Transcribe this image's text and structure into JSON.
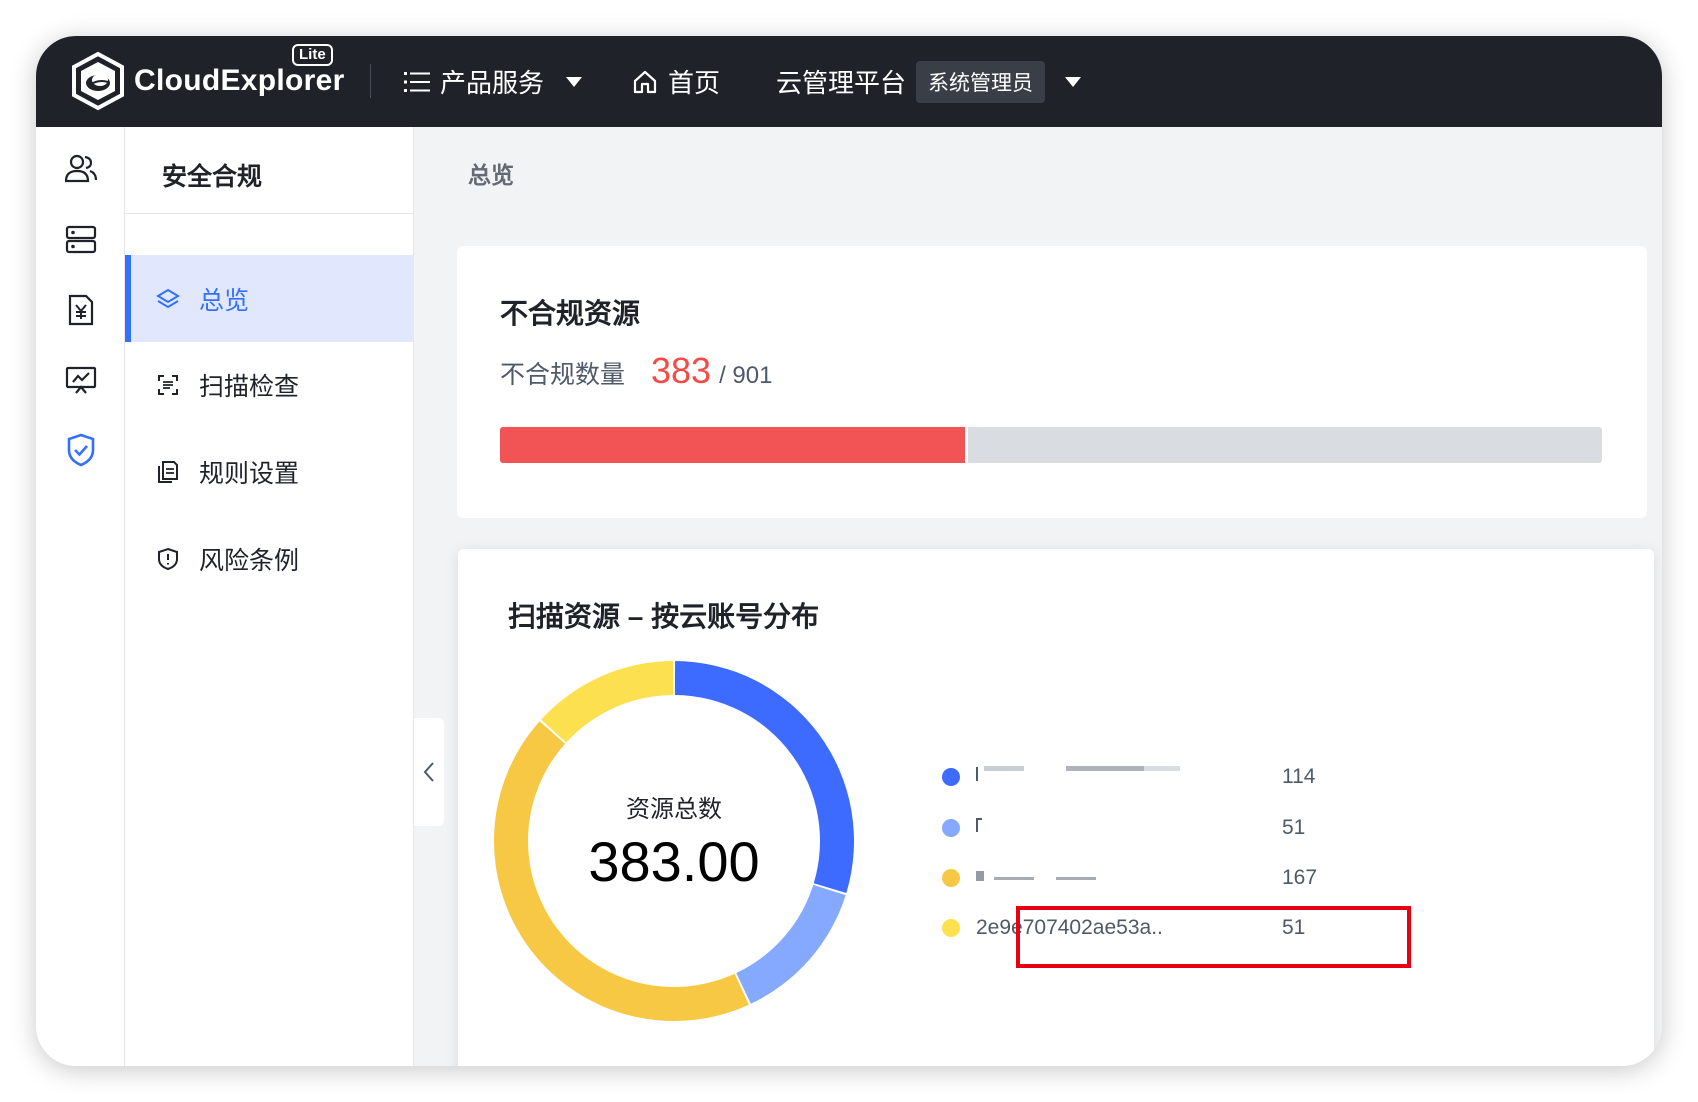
{
  "app": {
    "logo_text": "CloudExplorer",
    "logo_badge": "Lite"
  },
  "topnav": {
    "products_label": "产品服务",
    "home_label": "首页",
    "platform_label": "云管理平台",
    "role_badge": "系统管理员"
  },
  "rail": {
    "icons": [
      "users-icon",
      "server-icon",
      "billing-icon",
      "monitor-icon",
      "shield-icon"
    ],
    "active": "shield-icon"
  },
  "menu": {
    "title": "安全合规",
    "items": [
      {
        "label": "总览",
        "icon": "layers-icon",
        "active": true
      },
      {
        "label": "扫描检查",
        "icon": "scan-icon",
        "active": false
      },
      {
        "label": "规则设置",
        "icon": "rules-doc-icon",
        "active": false
      },
      {
        "label": "风险条例",
        "icon": "risk-shield-icon",
        "active": false
      }
    ]
  },
  "breadcrumb": "总览",
  "noncompliant_card": {
    "title": "不合规资源",
    "count_label": "不合规数量",
    "count": "383",
    "total": "/ 901",
    "progress_fraction": 0.425
  },
  "scan_card": {
    "title": "扫描资源 – 按云账号分布",
    "center_label": "资源总数",
    "center_value": "383.00"
  },
  "chart_data": {
    "type": "pie",
    "donut": true,
    "total": 383,
    "series": [
      {
        "name": "",
        "value": 114,
        "color": "#3d6bff"
      },
      {
        "name": "",
        "value": 51,
        "color": "#85a9ff"
      },
      {
        "name": "",
        "value": 167,
        "color": "#f7c843"
      },
      {
        "name": "2e9e707402ae53a..",
        "value": 51,
        "color": "#fde04f"
      }
    ],
    "legend_values": [
      "114",
      "51",
      "167",
      "51"
    ]
  },
  "colors": {
    "accent": "#3370ff",
    "danger": "#f54a45",
    "topbar": "#1f2329",
    "highlight": "#e60012"
  }
}
